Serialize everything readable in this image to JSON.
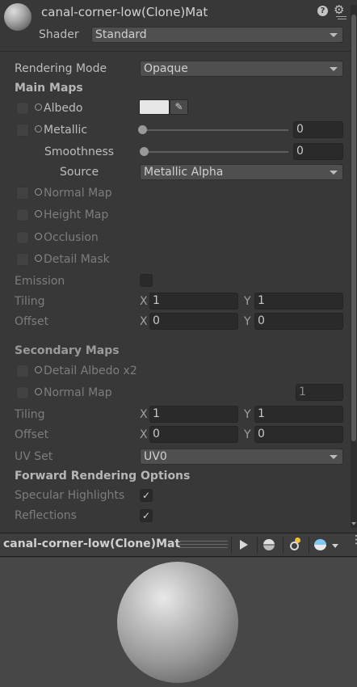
{
  "header": {
    "material_name": "canal-corner-low(Clone)Mat",
    "shader_label": "Shader",
    "shader_value": "Standard",
    "help_icon": "help-icon",
    "settings_icon": "gear-icon"
  },
  "rendering_mode": {
    "label": "Rendering Mode",
    "value": "Opaque"
  },
  "main_maps": {
    "title": "Main Maps",
    "albedo": "Albedo",
    "metallic": "Metallic",
    "metallic_value": "0",
    "smoothness": "Smoothness",
    "smoothness_value": "0",
    "source_label": "Source",
    "source_value": "Metallic Alpha",
    "normal_map": "Normal Map",
    "height_map": "Height Map",
    "occlusion": "Occlusion",
    "detail_mask": "Detail Mask",
    "emission": "Emission",
    "tiling_label": "Tiling",
    "tiling_x": "1",
    "tiling_y": "1",
    "offset_label": "Offset",
    "offset_x": "0",
    "offset_y": "0",
    "x_label": "X",
    "y_label": "Y"
  },
  "secondary_maps": {
    "title": "Secondary Maps",
    "detail_albedo": "Detail Albedo x2",
    "normal_map": "Normal Map",
    "normal_value": "1",
    "tiling_label": "Tiling",
    "tiling_x": "1",
    "tiling_y": "1",
    "offset_label": "Offset",
    "offset_x": "0",
    "offset_y": "0",
    "uv_set_label": "UV Set",
    "uv_set_value": "UV0"
  },
  "forward_options": {
    "title": "Forward Rendering Options",
    "specular": "Specular Highlights",
    "reflections": "Reflections",
    "check": "✓"
  },
  "preview": {
    "title": "canal-corner-low(Clone)Mat"
  },
  "colors": {
    "panel_bg": "#383838",
    "field_bg": "#2a2a2a",
    "albedo_swatch": "#e6e6e6",
    "preview_bg": "#474747"
  }
}
